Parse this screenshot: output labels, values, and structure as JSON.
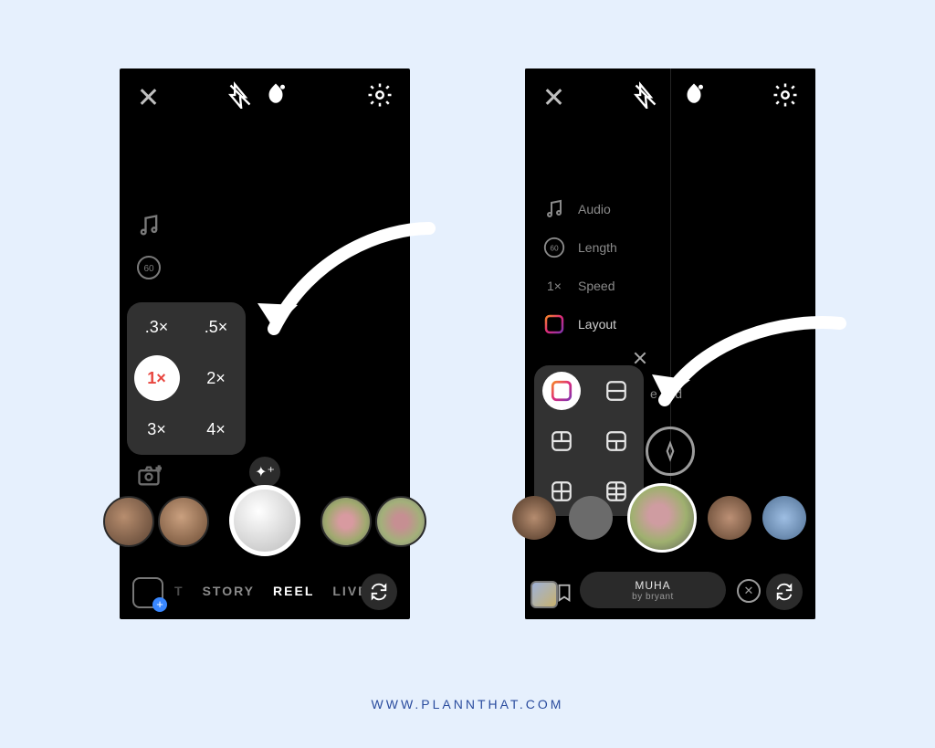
{
  "watermark": "WWW.PLANNTHAT.COM",
  "left": {
    "speed_options": [
      ".3×",
      ".5×",
      "1×",
      "2×",
      "3×",
      "4×"
    ],
    "speed_selected": "1×",
    "modes": [
      "T",
      "STORY",
      "REEL",
      "LIVE"
    ],
    "mode_active": "REEL",
    "length_icon": "60"
  },
  "right": {
    "tools": {
      "audio": "Audio",
      "length": "Length",
      "length_icon": "60",
      "speed": "Speed",
      "speed_icon": "1×",
      "layout": "Layout",
      "grid": "e grid"
    },
    "effect": {
      "name": "MUHA",
      "author": "by bryant"
    }
  }
}
